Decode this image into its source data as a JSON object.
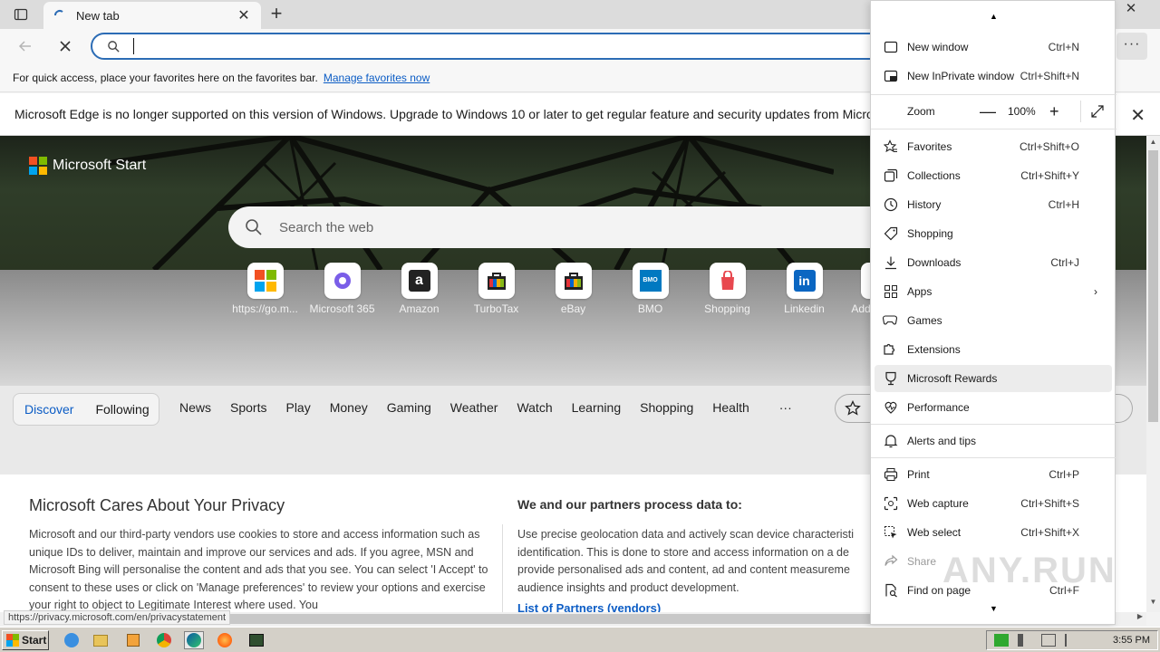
{
  "tabbar": {
    "tab_title": "New tab",
    "close_glyph": "✕",
    "new_tab_glyph": "+",
    "window_close_glyph": "✕"
  },
  "toolbar": {
    "search_value": "",
    "more_glyph": "···"
  },
  "favbar": {
    "text": "For quick access, place your favorites here on the favorites bar.",
    "link": "Manage favorites now"
  },
  "infobar": {
    "text": "Microsoft Edge is no longer supported on this version of Windows. Upgrade to Windows 10 or later to get regular feature and security updates from Microsoft E"
  },
  "page": {
    "brand": "Microsoft Start",
    "search_placeholder": "Search the web",
    "tiles": [
      {
        "label": "https://go.m...",
        "icon": "microsoft-logo-icon"
      },
      {
        "label": "Microsoft 365",
        "icon": "microsoft-365-icon"
      },
      {
        "label": "Amazon",
        "icon": "amazon-icon"
      },
      {
        "label": "TurboTax",
        "icon": "shopping-bag-icon"
      },
      {
        "label": "eBay",
        "icon": "shopping-bag-icon"
      },
      {
        "label": "BMO",
        "icon": "bmo-icon"
      },
      {
        "label": "Shopping",
        "icon": "shopping-icon"
      },
      {
        "label": "Linkedin",
        "icon": "linkedin-icon"
      },
      {
        "label": "Add",
        "icon": "add-icon"
      }
    ],
    "segments": [
      "Discover",
      "Following"
    ],
    "categories": [
      "News",
      "Sports",
      "Play",
      "Money",
      "Gaming",
      "Weather",
      "Watch",
      "Learning",
      "Shopping",
      "Health",
      "···"
    ],
    "privacy": {
      "title": "Microsoft Cares About Your Privacy",
      "body": "Microsoft and our third-party vendors use cookies to store and access information such as unique IDs to deliver, maintain and improve our services and ads. If you agree, MSN and Microsoft Bing will personalise the content and ads that you see. You can select 'I Accept' to consent to these uses or click on 'Manage preferences' to review your options and exercise your right to object to Legitimate Interest where used.  You",
      "right_title": "We and our partners process data to:",
      "right_body_lines": [
        "Use precise geolocation data and actively scan device characteristi",
        "identification. This is done to store and access information on a de",
        "provide personalised ads and content, ad and content measureme",
        "audience insights and product development."
      ],
      "partners_link": "List of Partners (vendors)"
    },
    "status_url": "https://privacy.microsoft.com/en/privacystatement"
  },
  "menu": {
    "items": [
      {
        "label": "New window",
        "shortcut": "Ctrl+N",
        "icon": "new-window-icon"
      },
      {
        "label": "New InPrivate window",
        "shortcut": "Ctrl+Shift+N",
        "icon": "inprivate-icon"
      },
      {
        "label": "Favorites",
        "shortcut": "Ctrl+Shift+O",
        "icon": "favorites-icon"
      },
      {
        "label": "Collections",
        "shortcut": "Ctrl+Shift+Y",
        "icon": "collections-icon"
      },
      {
        "label": "History",
        "shortcut": "Ctrl+H",
        "icon": "history-icon"
      },
      {
        "label": "Shopping",
        "shortcut": "",
        "icon": "shopping-tag-icon"
      },
      {
        "label": "Downloads",
        "shortcut": "Ctrl+J",
        "icon": "download-icon"
      },
      {
        "label": "Apps",
        "shortcut": "",
        "icon": "apps-icon"
      },
      {
        "label": "Games",
        "shortcut": "",
        "icon": "games-icon"
      },
      {
        "label": "Extensions",
        "shortcut": "",
        "icon": "extensions-icon"
      },
      {
        "label": "Microsoft Rewards",
        "shortcut": "",
        "icon": "rewards-icon"
      },
      {
        "label": "Performance",
        "shortcut": "",
        "icon": "performance-icon"
      },
      {
        "label": "Alerts and tips",
        "shortcut": "",
        "icon": "bell-icon"
      },
      {
        "label": "Print",
        "shortcut": "Ctrl+P",
        "icon": "print-icon"
      },
      {
        "label": "Web capture",
        "shortcut": "Ctrl+Shift+S",
        "icon": "web-capture-icon"
      },
      {
        "label": "Web select",
        "shortcut": "Ctrl+Shift+X",
        "icon": "web-select-icon"
      },
      {
        "label": "Share",
        "shortcut": "",
        "icon": "share-icon"
      },
      {
        "label": "Find on page",
        "shortcut": "Ctrl+F",
        "icon": "find-icon"
      }
    ],
    "zoom": {
      "label": "Zoom",
      "value": "100%",
      "minus": "—",
      "plus": "+"
    },
    "apps_arrow": "›"
  },
  "taskbar": {
    "start_label": "Start",
    "clock": "3:55 PM"
  },
  "watermark": "ANY.RUN",
  "colors": {
    "accent": "#0b5cc5",
    "address_border": "#2c6cb5"
  }
}
